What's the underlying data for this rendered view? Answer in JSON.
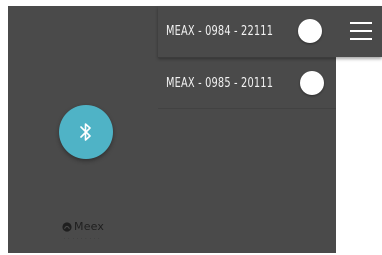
{
  "devices": [
    {
      "label": "MEAX - 0984 - 22111",
      "toggle_on": false
    },
    {
      "label": "MEAX - 0985 - 20111",
      "toggle_on": false
    }
  ],
  "menu": {
    "icon": "hamburger-menu-icon"
  },
  "bluetooth_button": {
    "icon": "bluetooth-icon",
    "color": "#4fb3c6"
  },
  "logo": {
    "text": "Meex",
    "tagline": "· · · · · · · · ·",
    "icon": "meex-logo-icon"
  },
  "colors": {
    "panel": "#4a4a4a",
    "text": "#f2f2f2",
    "accent": "#4fb3c6",
    "background": "#ffffff"
  }
}
